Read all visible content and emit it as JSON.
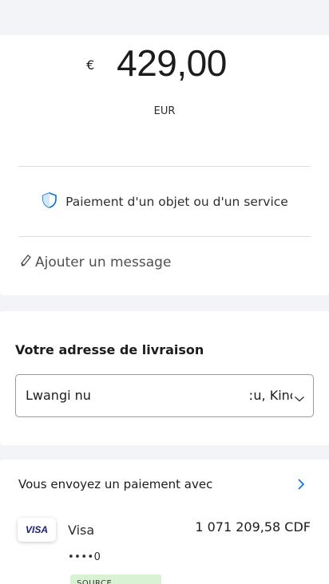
{
  "amount": {
    "currency_symbol": "€",
    "value": "429,00",
    "currency_code": "EUR"
  },
  "purpose": {
    "icon": "shield-icon",
    "label": "Paiement d'un objet ou d'un service"
  },
  "message": {
    "icon": "pencil-icon",
    "label": "Ajouter un message"
  },
  "shipping": {
    "title": "Votre adresse de livraison",
    "address_visible_left": "Lwangi nu",
    "address_visible_right": "ːu, Kinc"
  },
  "payment": {
    "heading": "Vous envoyez un paiement avec",
    "method": {
      "brand_badge": "VISA",
      "name": "Visa",
      "amount": "1 071 209,58 CDF",
      "card_number": "••••0",
      "source_badge": "SOURCE"
    }
  },
  "colors": {
    "background": "#f2f4f8",
    "card": "#ffffff",
    "accent_blue": "#0070e0",
    "visa_blue": "#1a1f71",
    "source_green": "#d9f2d3"
  }
}
